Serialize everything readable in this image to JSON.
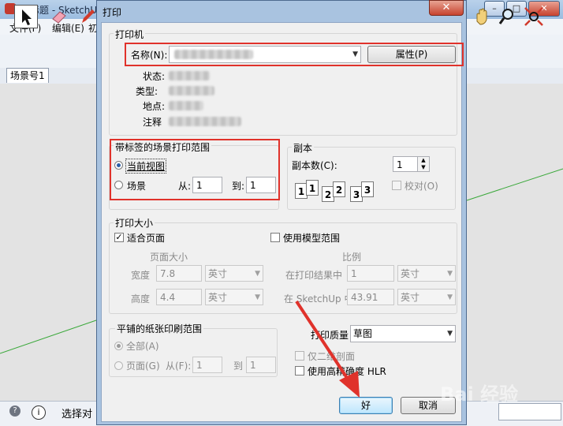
{
  "bg": {
    "title": "无标题 - SketchU",
    "menu": [
      "文件(F)",
      "编辑(E)",
      "初"
    ],
    "scene_tab": "场景号1",
    "status_text": "选择对"
  },
  "dialog": {
    "title": "打印",
    "close_label": "✕",
    "printer": {
      "legend": "打印机",
      "name_label": "名称(N):",
      "properties_button": "属性(P)",
      "status_label": "状态:",
      "type_label": "类型:",
      "where_label": "地点:",
      "comment_label": "注释"
    },
    "scene_range": {
      "legend": "带标签的场景打印范围",
      "current_view": "当前视图",
      "scenes": "场景",
      "from_label": "从:",
      "from_value": "1",
      "to_label": "到:",
      "to_value": "1"
    },
    "copies": {
      "legend": "副本",
      "count_label": "副本数(C):",
      "count_value": "1",
      "collate_label": "校对(O)"
    },
    "print_size": {
      "legend": "打印大小",
      "fit_page": "适合页面",
      "use_model_extents": "使用模型范围",
      "page_size_label": "页面大小",
      "width_label": "宽度",
      "width_value": "7.8",
      "width_unit": "英寸",
      "height_label": "高度",
      "height_value": "4.4",
      "height_unit": "英寸",
      "scale_label": "比例",
      "in_printout_label": "在打印结果中",
      "in_printout_value": "1",
      "in_printout_unit": "英寸",
      "in_sketchup_label": "在 SketchUp 中",
      "in_sketchup_value": "43.91",
      "in_sketchup_unit": "英寸"
    },
    "tiled": {
      "legend": "平铺的纸张印刷范围",
      "all": "全部(A)",
      "pages": "页面(G)",
      "from_label": "从(F):",
      "from_value": "1",
      "to_label": "到",
      "to_value": "1"
    },
    "quality": {
      "label": "打印质量",
      "value": "草图",
      "two_d_section": "仅二维剖面",
      "hlr": "使用高精确度 HLR"
    },
    "ok_button": "好",
    "cancel_button": "取消"
  },
  "watermark": "Bai 经验"
}
